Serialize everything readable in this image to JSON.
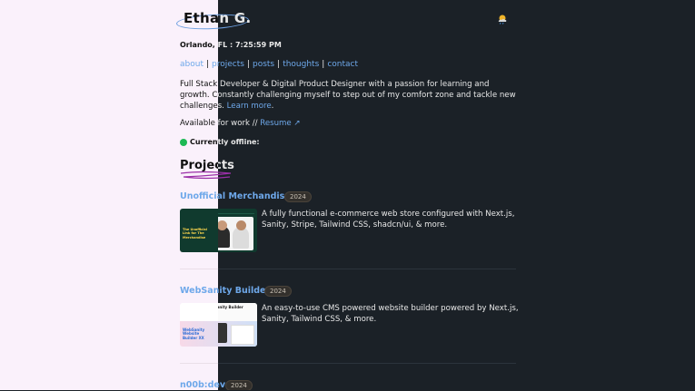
{
  "header": {
    "name": "Ethan G."
  },
  "location": "Orlando, FL : 7:25:59 PM",
  "nav": {
    "about": "about",
    "projects": "projects",
    "posts": "posts",
    "thoughts": "thoughts",
    "contact": "contact",
    "separator": "|"
  },
  "bio": {
    "text": "Full Stack Developer & Digital Product Designer with a passion for learning and growth. Constantly challenging myself to step out of my comfort zone and tackle new challenges.",
    "learn_more": "Learn more",
    "period": "."
  },
  "availability": {
    "text": "Available for work // ",
    "resume": "Resume ↗"
  },
  "status": {
    "text": "Currently offline:"
  },
  "projects": {
    "heading": "Projects",
    "items": [
      {
        "title": "Unofficial Merchandise",
        "year": "2024",
        "desc": "A fully functional e-commerce web store configured with Next.js, Sanity, Stripe, Tailwind CSS, shadcn/ui, & more.",
        "thumb_text": "The Unofficial Link for The Merchandise"
      },
      {
        "title": "WebSanity Builder",
        "year": "2024",
        "desc": "An easy-to-use CMS powered website builder powered by Next.js, Sanity, Tailwind CSS, & more.",
        "thumb_title": "WebSanity Builder",
        "thumb_text": "WebSanity Website Builder XX"
      },
      {
        "title": "n00b:dev",
        "year": "2024"
      }
    ]
  },
  "colors": {
    "link": "#6ea8ea",
    "dark_bg": "#1b2127",
    "light_bg": "#faf1fb",
    "status_green": "#1db954",
    "underline": "#9b2fa8"
  }
}
